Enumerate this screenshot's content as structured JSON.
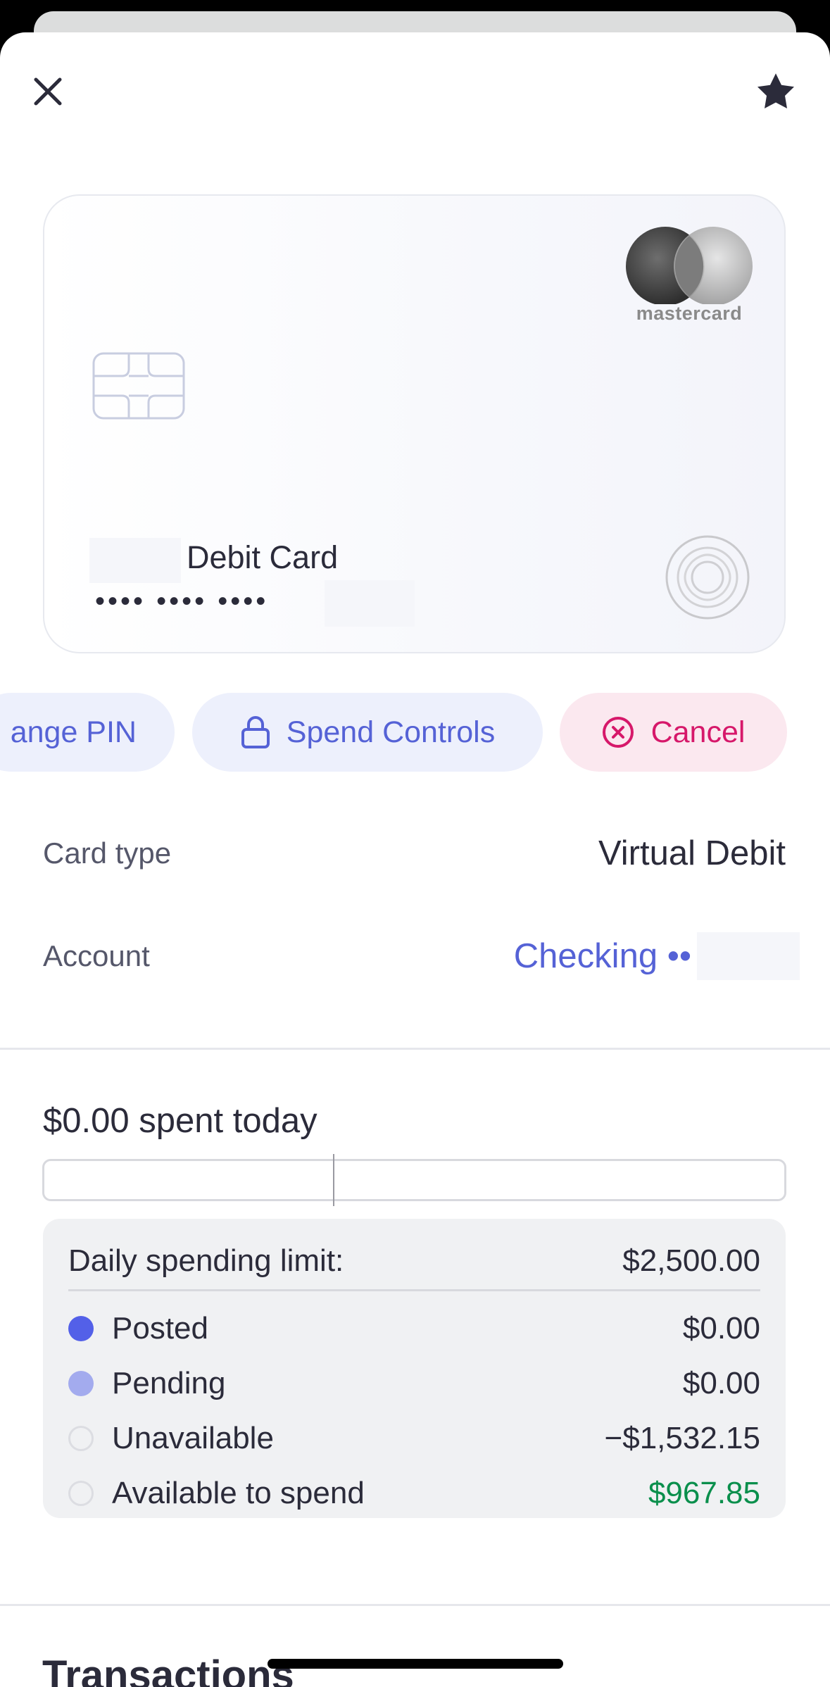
{
  "header": {
    "close_icon": "close-icon",
    "favorite_icon": "star-icon"
  },
  "card": {
    "brand_text": "mastercard",
    "name": "Debit Card",
    "number_masked": "•••• •••• ••••",
    "chip_icon": "card-chip-icon",
    "contactless_icon": "card-seal-icon"
  },
  "actions": {
    "change_pin_label": "ange PIN",
    "spend_controls_label": "Spend Controls",
    "cancel_label": "Cancel"
  },
  "details": {
    "card_type_label": "Card type",
    "card_type_value": "Virtual Debit",
    "account_label": "Account",
    "account_value": "Checking ••"
  },
  "spending": {
    "spent_today": "$0.00 spent today",
    "progress_fraction": 0,
    "daily_limit_label": "Daily spending limit:",
    "daily_limit_value": "$2,500.00",
    "items": [
      {
        "label": "Posted",
        "value": "$0.00"
      },
      {
        "label": "Pending",
        "value": "$0.00"
      },
      {
        "label": "Unavailable",
        "value": "−$1,532.15"
      },
      {
        "label": "Available to spend",
        "value": "$967.85"
      }
    ],
    "colors": {
      "posted": "#5360e8",
      "pending": "#a3abee",
      "available": "#0a8f4c"
    }
  },
  "transactions": {
    "heading": "Transactions"
  }
}
